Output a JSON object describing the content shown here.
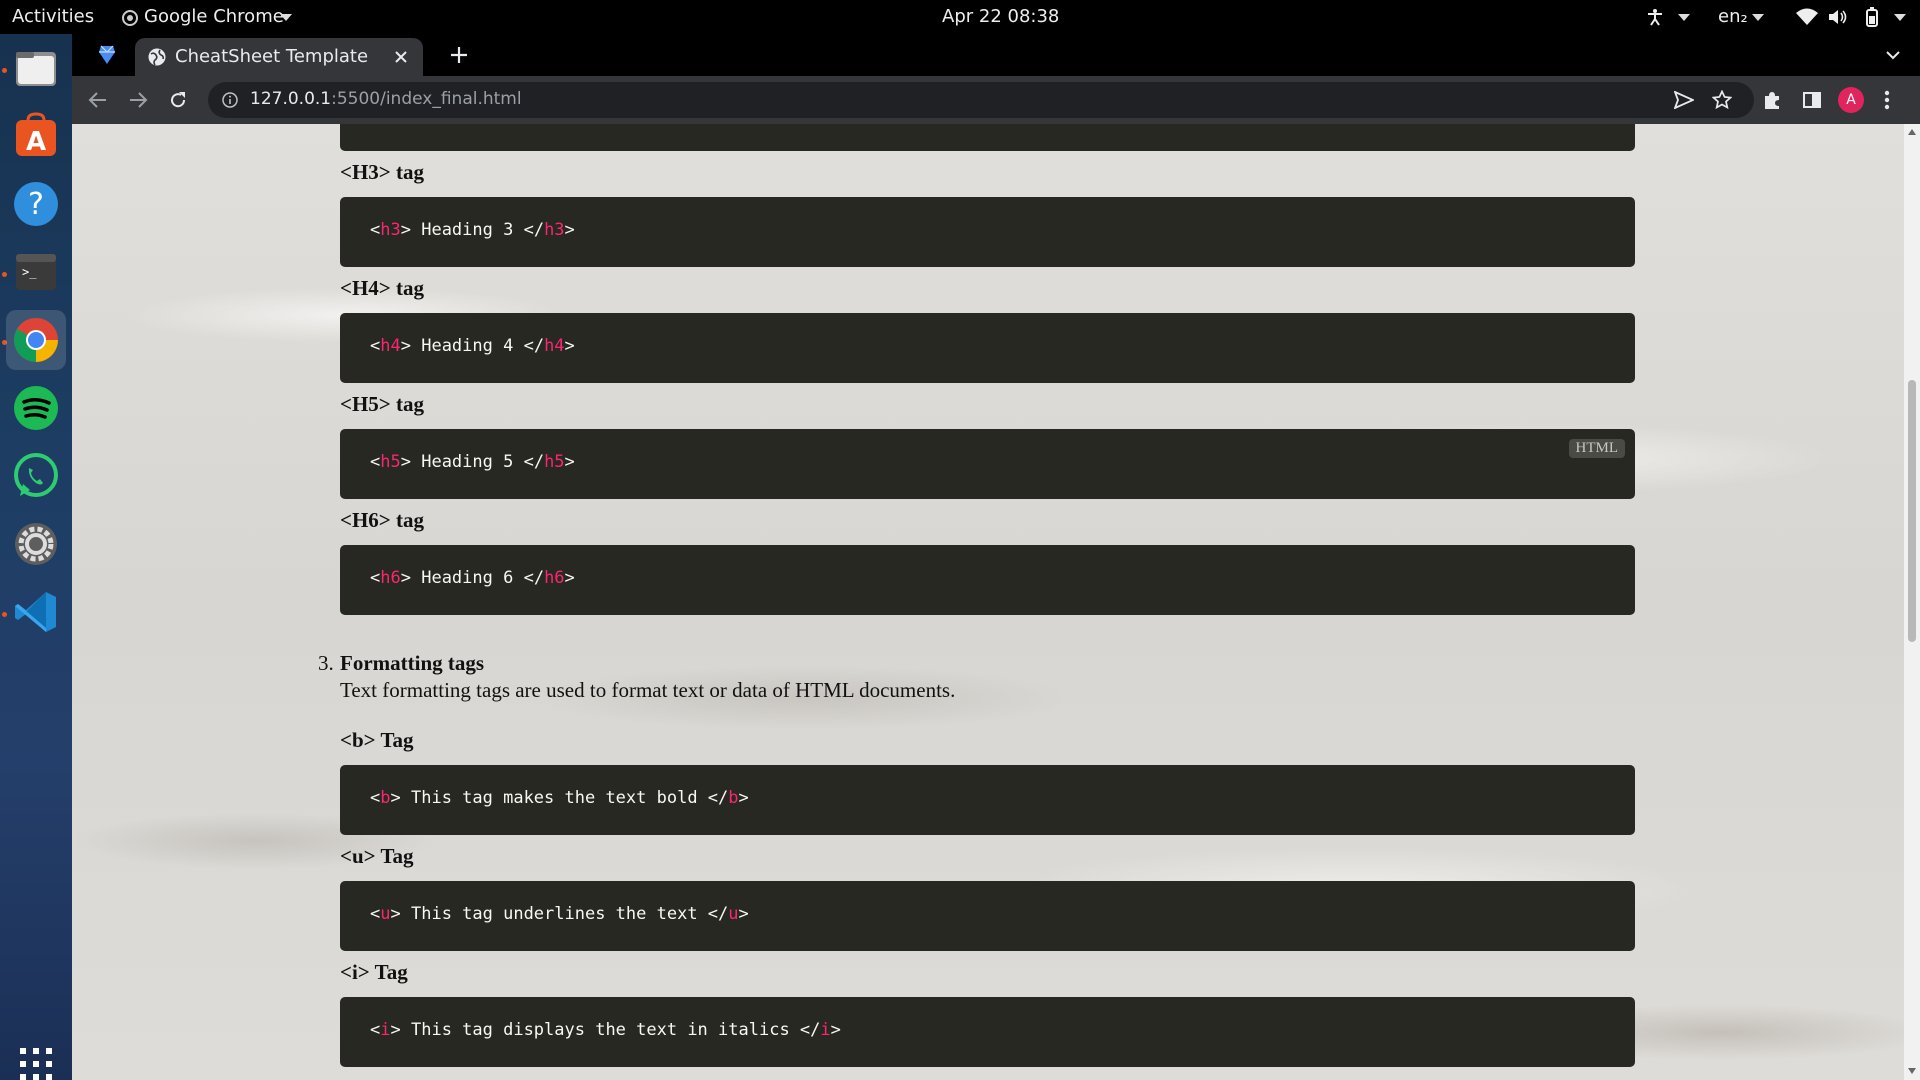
{
  "topbar": {
    "activities": "Activities",
    "app_menu": "Google Chrome",
    "clock": "Apr 22  08:38",
    "language": "en₂"
  },
  "dock": {
    "items": [
      {
        "name": "files"
      },
      {
        "name": "ubuntu-software"
      },
      {
        "name": "help"
      },
      {
        "name": "terminal"
      },
      {
        "name": "google-chrome"
      },
      {
        "name": "spotify"
      },
      {
        "name": "whatsapp"
      },
      {
        "name": "settings"
      },
      {
        "name": "visual-studio-code"
      },
      {
        "name": "show-applications"
      }
    ]
  },
  "browser": {
    "tab_title": "CheatSheet Template",
    "url_host": "127.0.0.1",
    "url_path": ":5500/index_final.html",
    "profile_initial": "A"
  },
  "page": {
    "sections": [
      {
        "heading": "<H3> tag",
        "code": {
          "tag": "h3",
          "text": "Heading 3"
        }
      },
      {
        "heading": "<H4> tag",
        "code": {
          "tag": "h4",
          "text": "Heading 4"
        }
      },
      {
        "heading": "<H5> tag",
        "code": {
          "tag": "h5",
          "text": "Heading 5"
        },
        "badge": "HTML"
      },
      {
        "heading": "<H6> tag",
        "code": {
          "tag": "h6",
          "text": "Heading 6"
        }
      }
    ],
    "formatting": {
      "number": "3.",
      "title": "Formatting tags",
      "description": "Text formatting tags are used to format text or data of HTML documents.",
      "items": [
        {
          "heading": "<b> Tag",
          "code": {
            "tag": "b",
            "text": "This tag makes the text bold"
          }
        },
        {
          "heading": "<u> Tag",
          "code": {
            "tag": "u",
            "text": "This tag underlines the text"
          }
        },
        {
          "heading": "<i> Tag",
          "code": {
            "tag": "i",
            "text": "This tag displays the text in italics"
          }
        }
      ]
    }
  },
  "colors": {
    "code_bg": "#272822",
    "tag_pink": "#f92672",
    "code_text": "#f8f8f2"
  }
}
